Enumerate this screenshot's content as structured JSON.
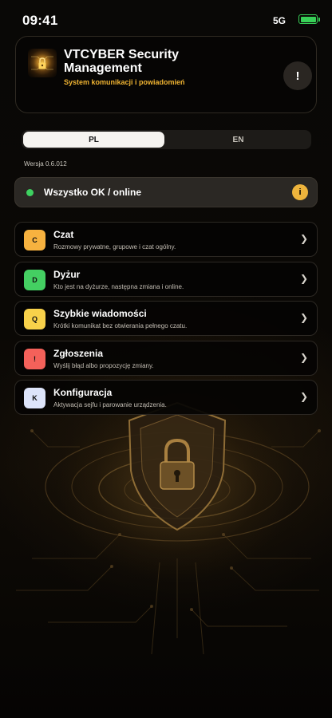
{
  "status_bar": {
    "time": "09:41",
    "network": "5G",
    "battery_level": 1.0
  },
  "header": {
    "title": "VTCYBER Security Management",
    "subtitle": "System komunikacji i powiadomień",
    "alert_label": "!"
  },
  "language": {
    "options": [
      "PL",
      "EN"
    ],
    "selected": "PL"
  },
  "version": "Wersja 0.6.012",
  "status": {
    "text": "Wszystko OK / online",
    "info_label": "i"
  },
  "menu": [
    {
      "letter": "C",
      "title": "Czat",
      "description": "Rozmowy prywatne, grupowe i czat ogólny.",
      "color": "#f7b23f"
    },
    {
      "letter": "D",
      "title": "Dyżur",
      "description": "Kto jest na dyżurze, następna zmiana i online.",
      "color": "#44cf62"
    },
    {
      "letter": "Q",
      "title": "Szybkie wiadomości",
      "description": "Krótki komunikat bez otwierania pełnego czatu.",
      "color": "#f8d14a"
    },
    {
      "letter": "!",
      "title": "Zgłoszenia",
      "description": "Wyślij błąd albo propozycję zmiany.",
      "color": "#f4615a"
    },
    {
      "letter": "K",
      "title": "Konfiguracja",
      "description": "Aktywacja sejfu i parowanie urządzenia.",
      "color": "#dde4fa"
    }
  ],
  "menu_chevron": "❯",
  "colors": {
    "accent": "#f0b432",
    "online": "#3ed160",
    "battery": "#38d158"
  }
}
